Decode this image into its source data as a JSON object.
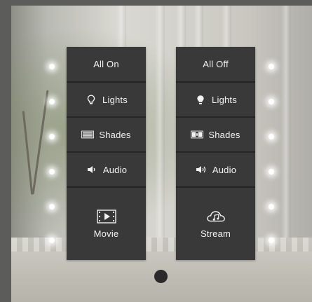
{
  "left_panel": {
    "all": "All On",
    "lights": "Lights",
    "shades": "Shades",
    "audio": "Audio",
    "scene": "Movie"
  },
  "right_panel": {
    "all": "All Off",
    "lights": "Lights",
    "shades": "Shades",
    "audio": "Audio",
    "scene": "Stream"
  },
  "icons": {
    "lights_on": "lightbulb-outline-icon",
    "lights_off": "lightbulb-filled-icon",
    "shades": "shades-icon",
    "audio_low": "speaker-icon",
    "audio_high": "speaker-waves-icon",
    "movie": "film-icon",
    "stream": "cloud-music-icon"
  },
  "colors": {
    "panel": "#2f302f",
    "button": "#383938",
    "text": "#f2f2f2",
    "led": "#ffffff"
  }
}
